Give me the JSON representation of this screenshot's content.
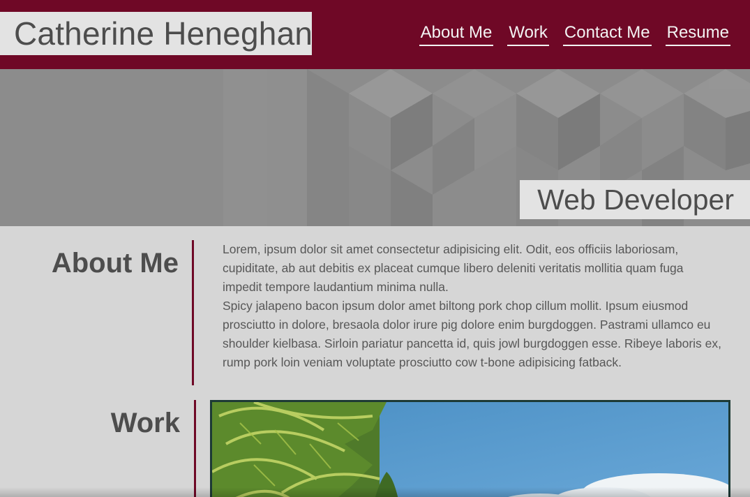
{
  "header": {
    "name": "Catherine Heneghan",
    "nav": [
      {
        "label": "About Me"
      },
      {
        "label": "Work"
      },
      {
        "label": "Contact Me"
      },
      {
        "label": "Resume"
      }
    ]
  },
  "hero": {
    "tagline": "Web Developer"
  },
  "about": {
    "heading": "About Me",
    "paragraphs": [
      "Lorem, ipsum dolor sit amet consectetur adipisicing elit. Odit, eos officiis laboriosam, cupiditate, ab aut debitis ex placeat cumque libero deleniti veritatis mollitia quam fuga impedit tempore laudantium minima nulla.",
      "Spicy jalapeno bacon ipsum dolor amet biltong pork chop cillum mollit. Ipsum eiusmod prosciutto in dolore, bresaola dolor irure pig dolore enim burgdoggen. Pastrami ullamco eu shoulder kielbasa. Sirloin pariatur pancetta id, quis jowl burgdoggen esse. Ribeye laboris ex, rump pork loin veniam voluptate prosciutto cow t-bone adipisicing fatback."
    ]
  },
  "work": {
    "heading": "Work",
    "image_icon": "palm-beach-image"
  },
  "colors": {
    "brand": "#6f0826",
    "background": "#d6d6d6",
    "label_bg": "#e3e3e3",
    "frame_border": "#1d3a35"
  }
}
